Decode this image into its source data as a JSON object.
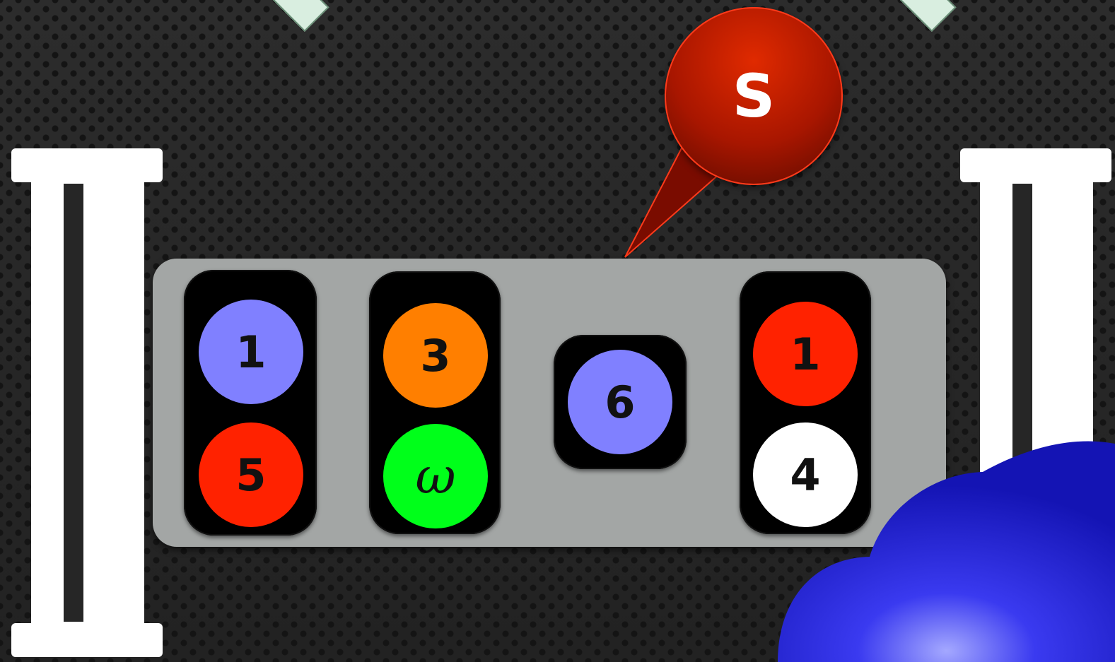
{
  "colors": {
    "background": "#262626",
    "tray": "#a3a6a5",
    "stack": "#000000",
    "bubble": "#c21a00",
    "cloud": "#2a2ad8"
  },
  "speech_bubble": {
    "label": "S"
  },
  "stacks": [
    {
      "balls": [
        {
          "label": "1",
          "color": "#8080ff"
        },
        {
          "label": "5",
          "color": "#ff2200"
        }
      ]
    },
    {
      "balls": [
        {
          "label": "3",
          "color": "#ff7f00"
        },
        {
          "label": "ω",
          "color": "#00ff1a"
        }
      ]
    },
    {
      "balls": [
        {
          "label": "6",
          "color": "#8080ff"
        }
      ]
    },
    {
      "balls": [
        {
          "label": "1",
          "color": "#ff2200"
        },
        {
          "label": "4",
          "color": "#ffffff"
        }
      ]
    }
  ]
}
